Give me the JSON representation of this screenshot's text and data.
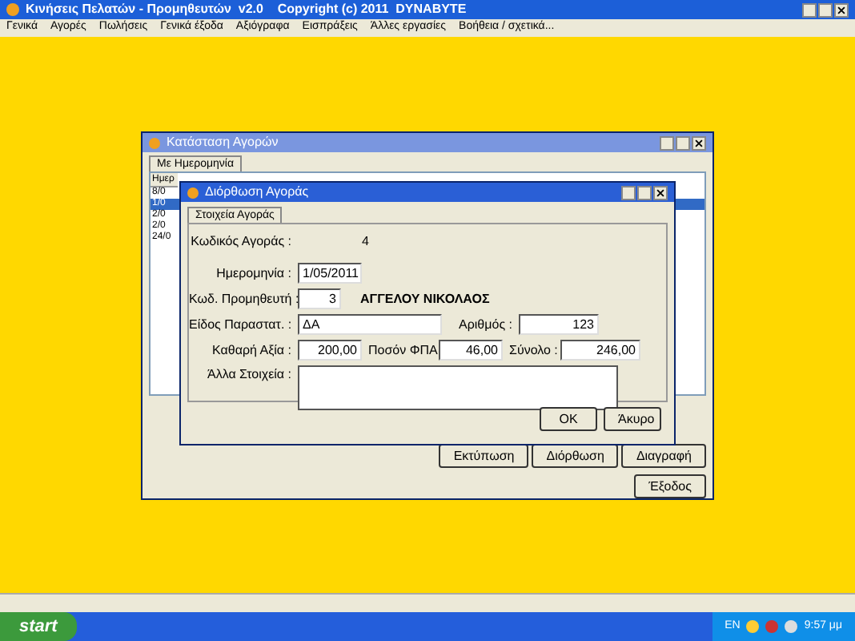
{
  "app": {
    "title": "Κινήσεις Πελατών - Προμηθευτών  v2.0    Copyright (c) 2011  DYNABYTE"
  },
  "menu": [
    "Γενικά",
    "Αγορές",
    "Πωλήσεις",
    "Γενικά έξοδα",
    "Αξιόγραφα",
    "Εισπράξεις",
    "Άλλες εργασίες",
    "Βοήθεια / σχετικά..."
  ],
  "list_window": {
    "title": "Κατάσταση Αγορών",
    "tab": "Με Ημερομηνία",
    "column_1": "Ημερ",
    "rows": [
      {
        "text": "8/0",
        "selected": false
      },
      {
        "text": "1/0",
        "selected": true
      },
      {
        "text": "2/0",
        "selected": false
      },
      {
        "text": "2/0",
        "selected": false
      },
      {
        "text": "24/0",
        "selected": false
      }
    ],
    "buttons": [
      "Εκτύπωση",
      "Διόρθωση",
      "Διαγραφή"
    ],
    "close_button": "Έξοδος"
  },
  "dialog": {
    "title": "Διόρθωση Αγοράς",
    "tab": "Στοιχεία Αγοράς",
    "code_label": "Κωδικός Αγοράς :",
    "code": "4",
    "date_label": "Ημερομηνία :",
    "date": "1/05/2011",
    "supplier_label": "Κωδ. Προμηθευτή :",
    "supplier_code": "3",
    "supplier_name": "ΑΓΓΕΛΟΥ ΝΙΚΟΛΑΟΣ",
    "doc_type_label": "Είδος Παραστατ. :",
    "doc_type": "ΔΑ",
    "number_label": "Αριθμός :",
    "number": "123",
    "net_label": "Καθαρή Αξία :",
    "net": "200,00",
    "vat_label": "Ποσόν ΦΠΑ",
    "vat": "46,00",
    "total_label": "Σύνολο :",
    "total": "246,00",
    "notes_label": "Άλλα Στοιχεία :",
    "ok": "OK",
    "cancel": "Άκυρο"
  },
  "taskbar": {
    "start": "start",
    "language": "EN",
    "clock": "9:57 μμ"
  }
}
